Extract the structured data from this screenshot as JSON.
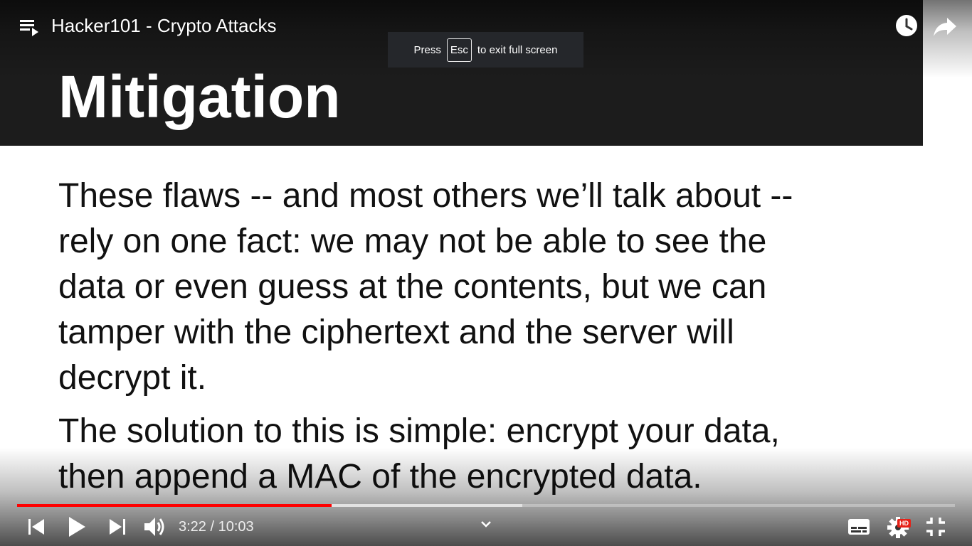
{
  "player": {
    "title": "Hacker101 - Crypto Attacks",
    "fullscreen_notice": {
      "before": "Press",
      "key": "Esc",
      "after": "to exit full screen"
    },
    "time": {
      "current": "3:22",
      "separator": "/",
      "duration": "10:03"
    },
    "progress_played_percent": 33.5,
    "progress_buffered_percent": 53.9,
    "quality_badge": "HD",
    "icons": {
      "playlist": "playlist-icon",
      "watch_later": "clock-icon",
      "share": "share-arrow-icon",
      "previous": "skip-previous-icon",
      "play": "play-icon",
      "next": "skip-next-icon",
      "volume": "volume-icon",
      "more": "chevron-down-icon",
      "subtitles": "subtitles-icon",
      "settings": "gear-icon",
      "exit_fullscreen": "exit-fullscreen-icon"
    },
    "colors": {
      "progress_played": "#ff0000",
      "hd_badge": "#e62117",
      "slide_header_bg": "#1c1c1c"
    }
  },
  "slide": {
    "title": "Mitigation",
    "paragraphs": [
      {
        "lines": [
          "These flaws -- and most others we’ll talk about --",
          "rely on one fact: we may not be able to see the",
          "data or even guess at the contents, but we can",
          "tamper with the ciphertext and the server will",
          "decrypt it."
        ]
      },
      {
        "lines": [
          "The solution to this is simple: encrypt your data,",
          "then append a MAC of the encrypted data."
        ]
      }
    ]
  }
}
